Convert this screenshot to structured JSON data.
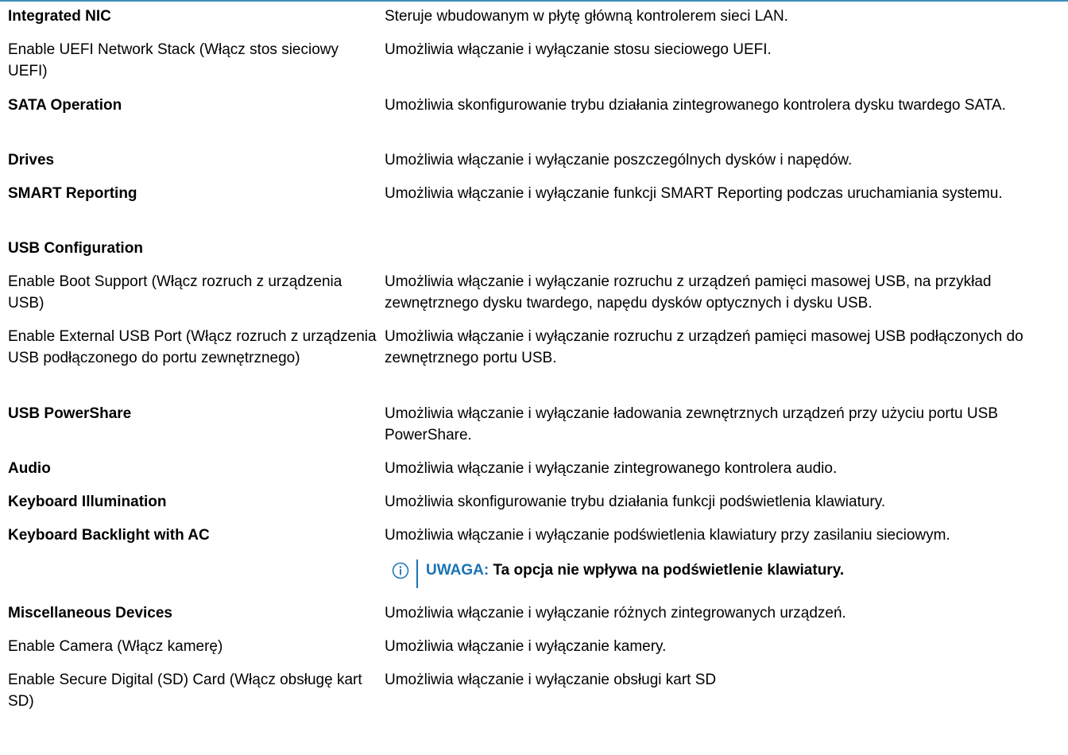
{
  "rows": [
    {
      "option": "Integrated NIC",
      "bold": true,
      "desc": "Steruje wbudowanym w płytę główną kontrolerem sieci LAN.",
      "h": 42
    },
    {
      "option": "Enable UEFI Network Stack (Włącz stos sieciowy UEFI)",
      "bold": false,
      "desc": "Umożliwia włączanie i wyłączanie stosu sieciowego UEFI.",
      "h": 70
    },
    {
      "option": "SATA Operation",
      "bold": true,
      "desc": "Umożliwia skonfigurowanie trybu działania zintegrowanego kontrolera dysku twardego SATA.",
      "h": 69
    },
    {
      "option": "Drives",
      "bold": true,
      "desc": "Umożliwia włączanie i wyłączanie poszczególnych dysków i napędów.",
      "h": 42
    },
    {
      "option": "SMART Reporting",
      "bold": true,
      "desc": "Umożliwia włączanie i wyłączanie funkcji SMART Reporting podczas uruchamiania systemu.",
      "h": 69
    },
    {
      "option": "USB Configuration",
      "bold": true,
      "desc": "",
      "h": 42
    },
    {
      "option": "Enable Boot Support (Włącz rozruch z urządzenia USB)",
      "bold": false,
      "desc": "Umożliwia włączanie i wyłączanie rozruchu z urządzeń pamięci masowej USB, na przykład zewnętrznego dysku twardego, napędu dysków optycznych i dysku USB.",
      "h": 69
    },
    {
      "option": "Enable External USB Port (Włącz rozruch z urządzenia USB podłączonego do portu zewnętrznego)",
      "bold": false,
      "desc": "Umożliwia włączanie i wyłączanie rozruchu z urządzeń pamięci masowej USB podłączonych do zewnętrznego portu USB.",
      "h": 97
    },
    {
      "option": "USB PowerShare",
      "bold": true,
      "desc": "Umożliwia włączanie i wyłączanie ładowania zewnętrznych urządzeń przy użyciu portu USB PowerShare.",
      "h": 69
    },
    {
      "option": "Audio",
      "bold": true,
      "desc": "Umożliwia włączanie i wyłączanie zintegrowanego kontrolera audio.",
      "h": 42
    },
    {
      "option": "Keyboard Illumination",
      "bold": true,
      "desc": "Umożliwia skonfigurowanie trybu działania funkcji podświetlenia klawiatury.",
      "h": 42
    },
    {
      "option": "Keyboard Backlight with AC",
      "bold": true,
      "desc": "Umożliwia włączanie i wyłączanie podświetlenia klawiatury przy zasilaniu sieciowym.",
      "h": 40
    }
  ],
  "note": {
    "label": "UWAGA:",
    "text": " Ta opcja nie wpływa na podświetlenie klawiatury."
  },
  "rows2": [
    {
      "option": "Miscellaneous Devices",
      "bold": true,
      "desc": "Umożliwia włączanie i wyłączanie różnych zintegrowanych urządzeń.",
      "h": 42
    },
    {
      "option": "Enable Camera (Włącz kamerę)",
      "bold": false,
      "desc": "Umożliwia włączanie i wyłączanie kamery.",
      "h": 42
    },
    {
      "option": "Enable Secure Digital (SD) Card (Włącz obsługę kart SD)",
      "bold": false,
      "desc": "Umożliwia włączanie i wyłączanie obsługi kart SD",
      "h": 60
    }
  ]
}
